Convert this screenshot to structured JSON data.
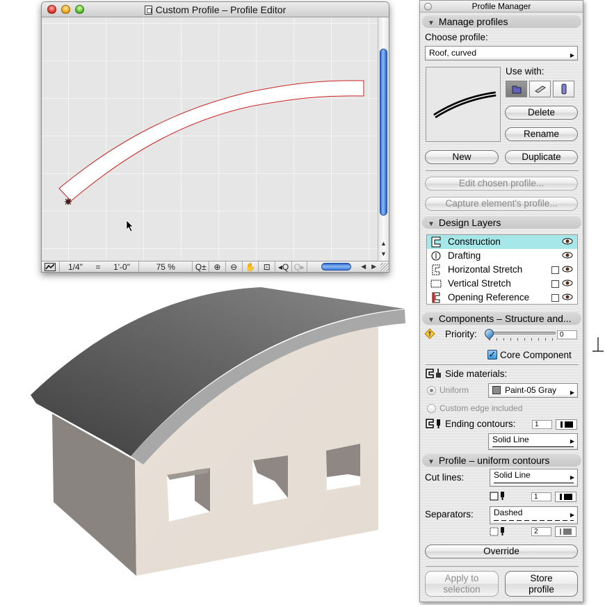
{
  "editor": {
    "title": "Custom Profile – Profile Editor",
    "scale_left": "1/4\"",
    "scale_eq": "=",
    "scale_right": "1'-0\"",
    "zoom": "75 %",
    "tools": [
      "zoom-toggle",
      "zoom-in",
      "zoom-out",
      "pan",
      "fit-in-window",
      "previous-zoom",
      "next-zoom"
    ],
    "stroke_color": "#cc2222"
  },
  "building": {
    "roof_color": "#5a5a5a",
    "wall_front_color": "#e8e0d8",
    "wall_side_color": "#8a8480"
  },
  "palette": {
    "title": "Profile Manager",
    "manage": {
      "header": "Manage profiles",
      "choose_label": "Choose profile:",
      "profile_value": "Roof, curved",
      "use_with_label": "Use with:",
      "use_with": [
        {
          "name": "slab-roof",
          "active": true
        },
        {
          "name": "beam",
          "active": false
        },
        {
          "name": "column",
          "active": false
        }
      ],
      "delete": "Delete",
      "rename": "Rename",
      "new": "New",
      "duplicate": "Duplicate",
      "edit": "Edit chosen profile...",
      "capture": "Capture element's profile..."
    },
    "layers": {
      "header": "Design Layers",
      "items": [
        {
          "label": "Construction",
          "selected": true,
          "has_checkbox": false
        },
        {
          "label": "Drafting",
          "selected": false,
          "has_checkbox": false
        },
        {
          "label": "Horizontal Stretch",
          "selected": false,
          "has_checkbox": true
        },
        {
          "label": "Vertical Stretch",
          "selected": false,
          "has_checkbox": true
        },
        {
          "label": "Opening Reference",
          "selected": false,
          "has_checkbox": true
        }
      ]
    },
    "components": {
      "header": "Components – Structure and...",
      "priority_label": "Priority:",
      "priority_value": "0",
      "core_label": "Core Component",
      "core_checked": true,
      "side_materials_label": "Side materials:",
      "uniform_label": "Uniform",
      "material_value": "Paint-05 Gray",
      "material_swatch": "#8a8a8a",
      "custom_edge_label": "Custom edge included",
      "ending_label": "Ending contours:",
      "ending_pen": "1",
      "ending_line": "Solid Line"
    },
    "contours": {
      "header": "Profile – uniform contours",
      "cut_label": "Cut lines:",
      "cut_line": "Solid Line",
      "cut_pen": "1",
      "sep_label": "Separators:",
      "sep_line": "Dashed",
      "sep_pen": "2",
      "override": "Override"
    },
    "apply_label_1": "Apply to",
    "apply_label_2": "selection",
    "store_label_1": "Store",
    "store_label_2": "profile"
  }
}
